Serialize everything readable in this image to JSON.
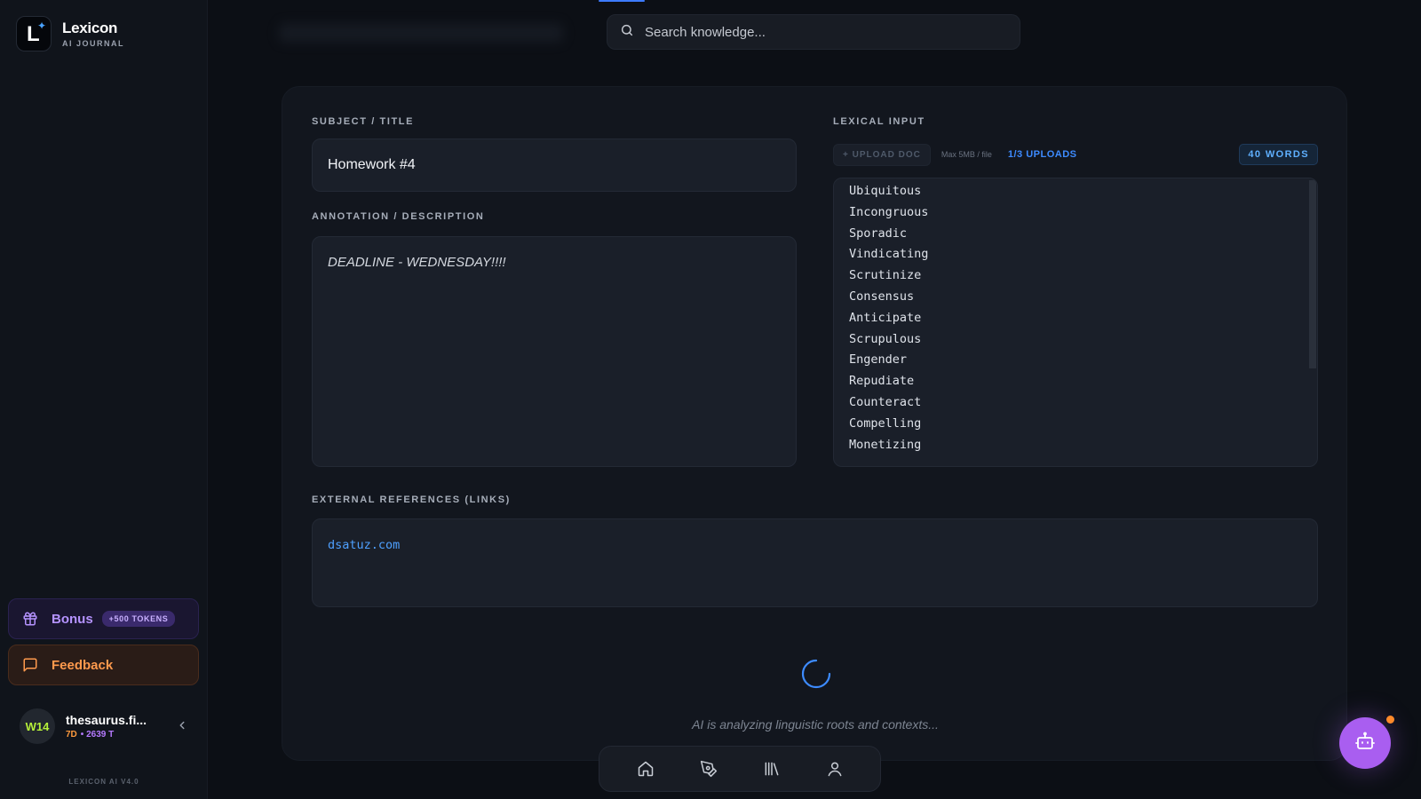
{
  "brand": {
    "name": "Lexicon",
    "subtitle": "AI JOURNAL"
  },
  "sidebar": {
    "bonus": {
      "label": "Bonus",
      "badge": "+500 TOKENS"
    },
    "feedback": {
      "label": "Feedback"
    },
    "user": {
      "avatar": "W14",
      "name": "thesaurus.fi...",
      "days": "7D",
      "tokens": "• 2639 T"
    },
    "version": "LEXICON AI V4.0"
  },
  "search": {
    "placeholder": "Search knowledge..."
  },
  "form": {
    "title_label": "SUBJECT / TITLE",
    "title_value": "Homework #4",
    "desc_label": "ANNOTATION / DESCRIPTION",
    "desc_value": "DEADLINE - WEDNESDAY!!!!",
    "lexical_label": "LEXICAL INPUT",
    "upload_button": "+ UPLOAD DOC",
    "max_note": "Max 5MB / file",
    "uploads_count": "1/3 UPLOADS",
    "word_count": "40 WORDS",
    "words": [
      "Ubiquitous",
      "Incongruous",
      "Sporadic",
      "Vindicating",
      "Scrutinize",
      "Consensus",
      "Anticipate",
      "Scrupulous",
      "Engender",
      "Repudiate",
      "Counteract",
      "Compelling",
      "Monetizing"
    ],
    "links_label": "EXTERNAL REFERENCES (LINKS)",
    "links_value": "dsatuz.com"
  },
  "status": {
    "analyzing": "AI is analyzing linguistic roots and contexts..."
  },
  "colors": {
    "accent": "#3d7bff",
    "bonus": "#b593ff",
    "feedback": "#ff9a4d",
    "bot": "#a95ef0"
  },
  "icons": {
    "search": "search-icon",
    "bonus": "gift-icon",
    "feedback": "chat-icon",
    "collapse": "chevron-left-icon",
    "nav": [
      "home-icon",
      "pen-icon",
      "library-icon",
      "user-icon"
    ],
    "bot": "robot-icon"
  }
}
